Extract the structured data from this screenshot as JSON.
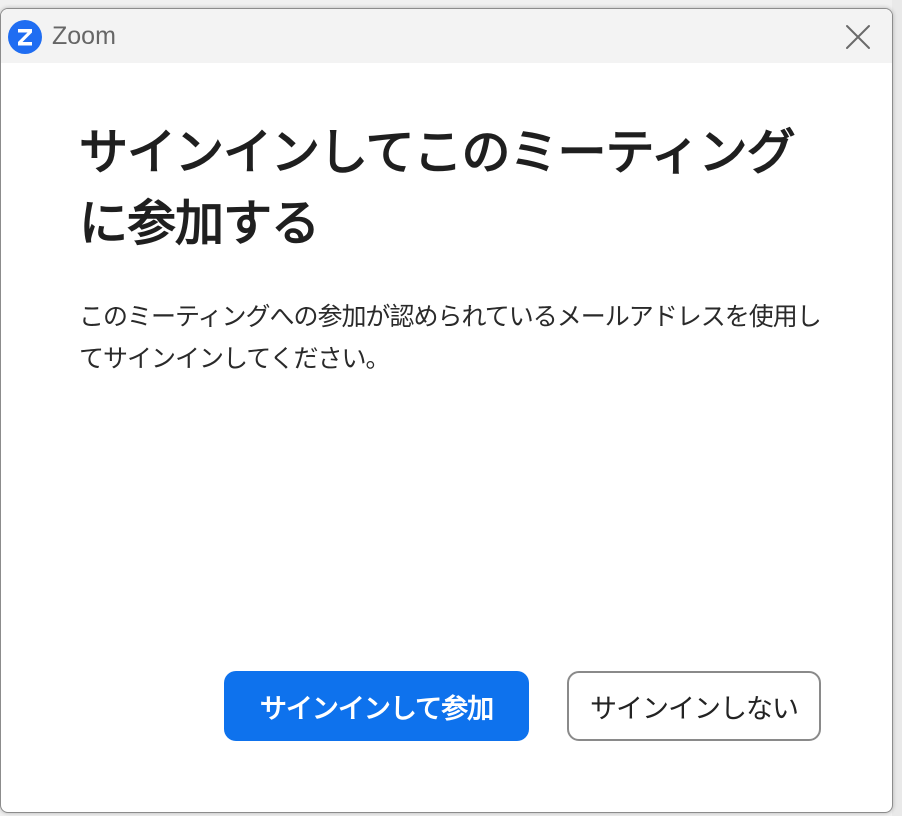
{
  "window": {
    "app_name": "Zoom",
    "logo_icon": "zoom-logo-icon",
    "close_icon": "close-icon"
  },
  "dialog": {
    "title": "サインインしてこのミーティングに参加する",
    "description": "このミーティングへの参加が認められているメールアドレスを使用してサインインしてください。",
    "primary_button": "サインインして参加",
    "secondary_button": "サインインしない"
  },
  "colors": {
    "accent": "#0E72ED",
    "logo": "#1F6DF2",
    "titlebar": "#F3F3F3"
  }
}
